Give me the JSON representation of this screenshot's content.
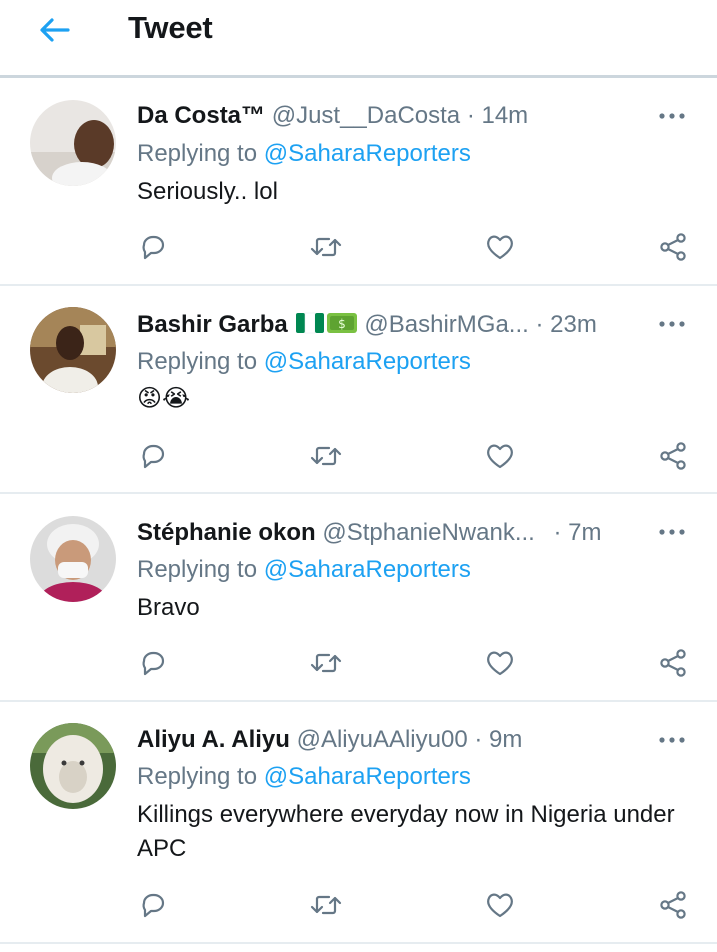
{
  "header": {
    "title": "Tweet",
    "back_icon": "back-arrow-icon"
  },
  "colors": {
    "accent": "#1da1f2",
    "muted": "#657786",
    "text": "#14171a",
    "divider": "#e6ecf0"
  },
  "replying_prefix": "Replying to",
  "tweets": [
    {
      "name": "Da Costa™",
      "handle": "@Just__DaCosta",
      "time": "· 14m",
      "replying_to": "@SaharaReporters",
      "text": "Seriously.. lol"
    },
    {
      "name": "Bashir Garba",
      "name_emojis": [
        "nigeria-flag",
        "money"
      ],
      "handle": "@BashirMGa...",
      "time": "· 23m",
      "replying_to": "@SaharaReporters",
      "text": "😡😭"
    },
    {
      "name": "Stéphanie okon",
      "handle": "@StphanieNwank...",
      "time": "· 7m",
      "replying_to": "@SaharaReporters",
      "text": "Bravo"
    },
    {
      "name": "Aliyu A. Aliyu",
      "handle": "@AliyuAAliyu00",
      "time": "· 9m",
      "replying_to": "@SaharaReporters",
      "text": "Killings everywhere everyday now in Nigeria under APC"
    }
  ]
}
